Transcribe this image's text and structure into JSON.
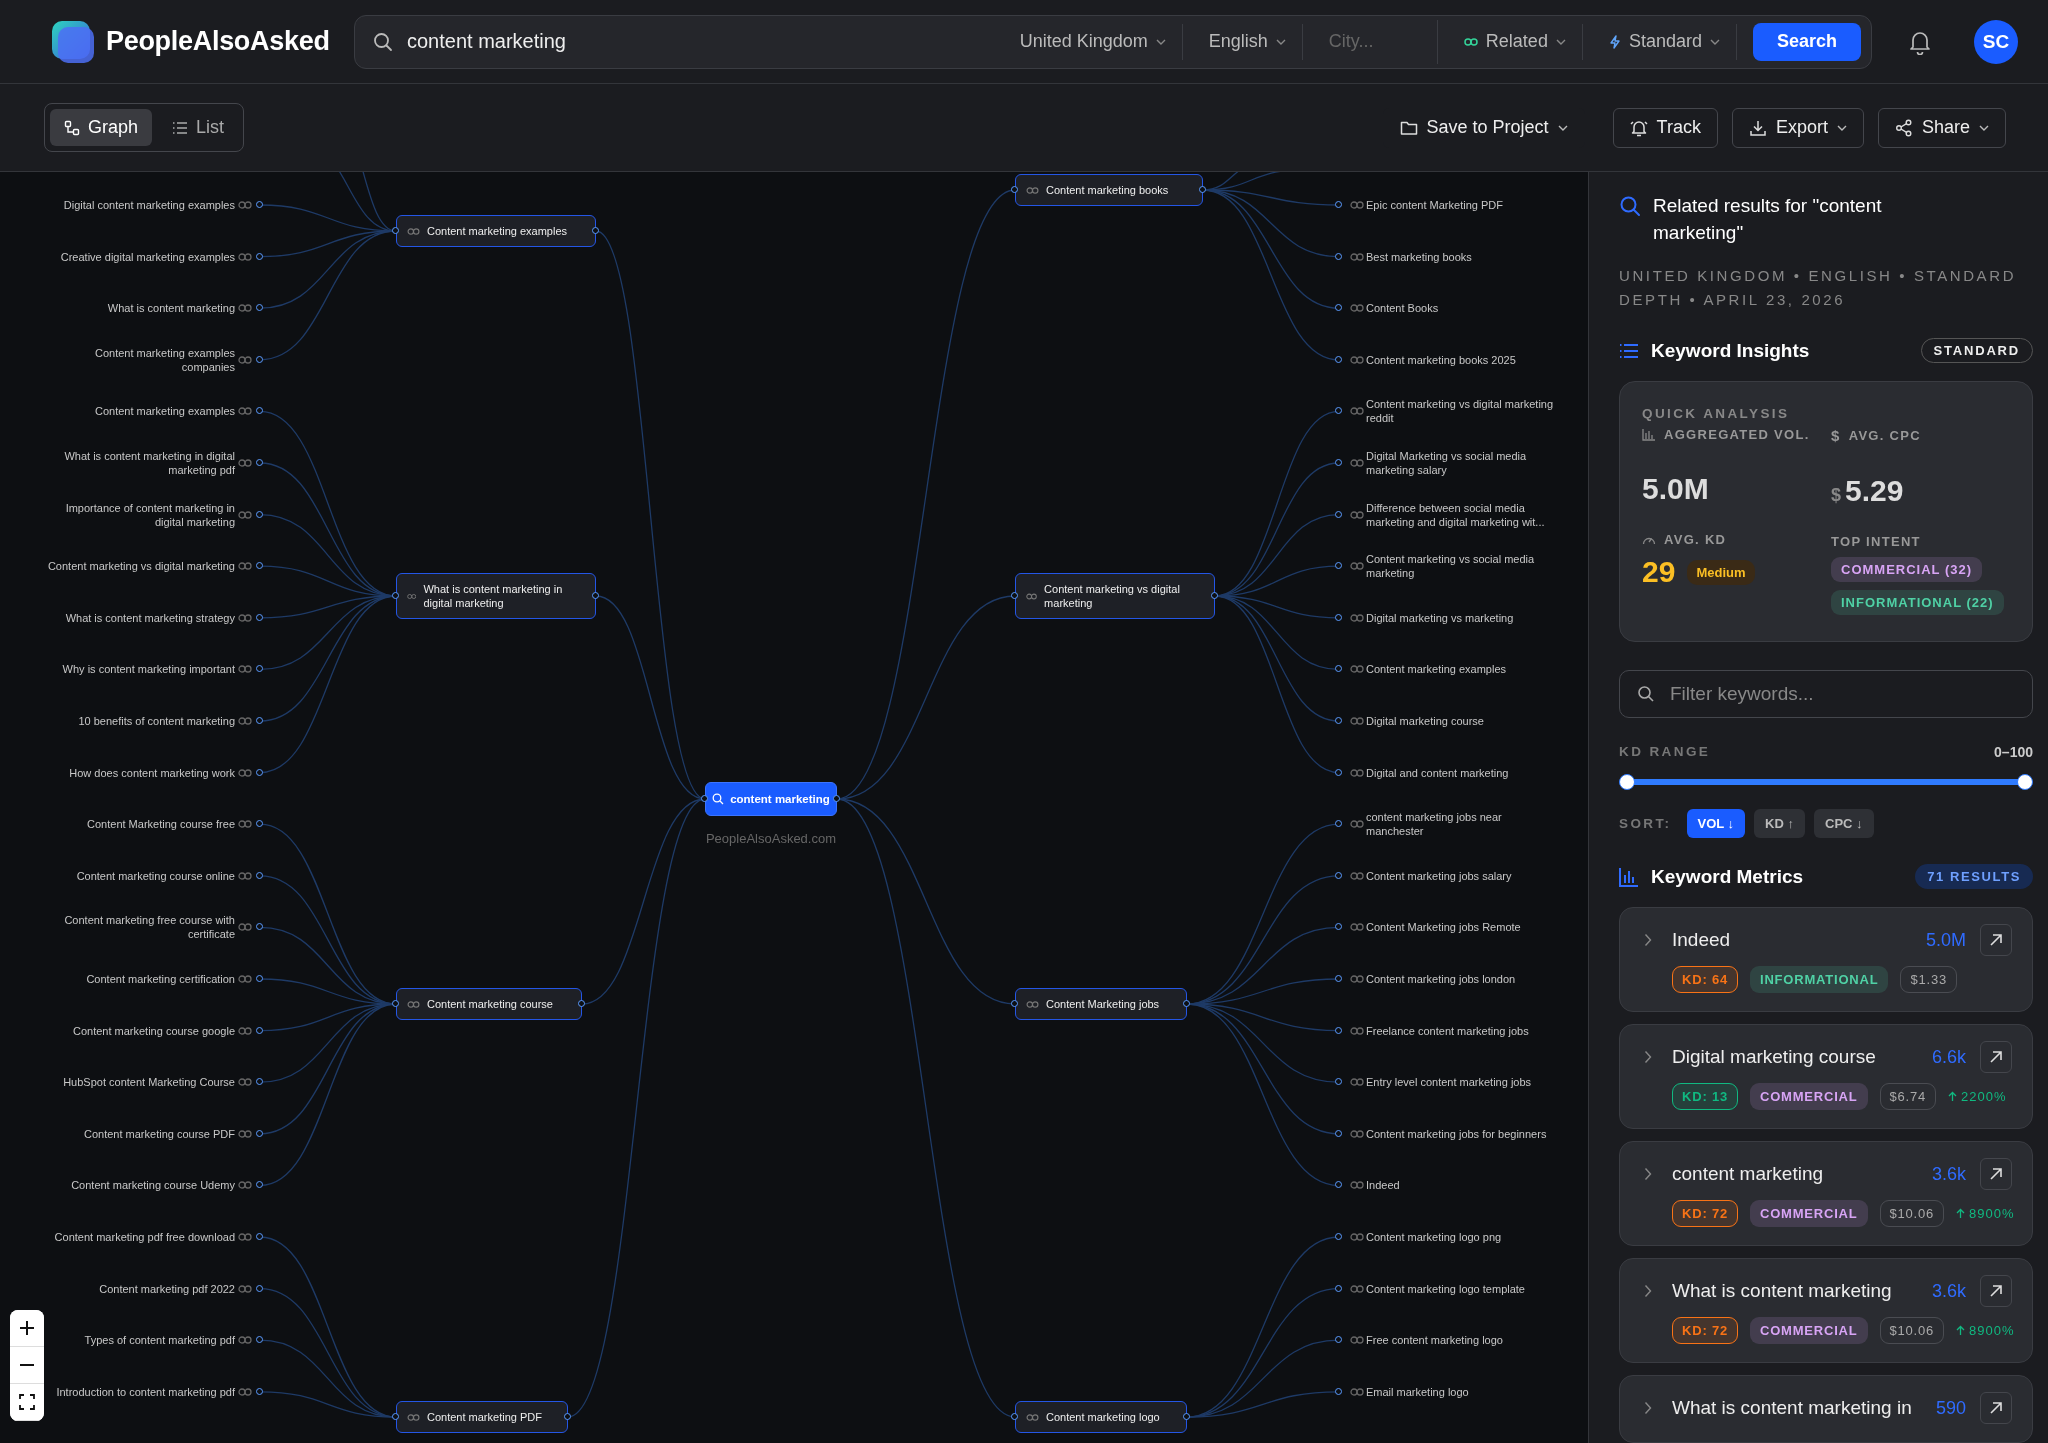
{
  "header": {
    "brand": "PeopleAlsoAsked",
    "query": "content marketing",
    "filters": [
      {
        "kind": "dropdown",
        "label": "United Kingdom"
      },
      {
        "kind": "dropdown",
        "label": "English"
      },
      {
        "kind": "input",
        "placeholder": "City..."
      },
      {
        "kind": "related",
        "label": "Related"
      },
      {
        "kind": "standard",
        "label": "Standard"
      }
    ],
    "search_button": "Search",
    "avatar": "SC"
  },
  "toolbar": {
    "views": [
      {
        "label": "Graph",
        "selected": true
      },
      {
        "label": "List",
        "selected": false
      }
    ],
    "actions": [
      {
        "kind": "folder",
        "label": "Save to Project",
        "menu": true
      },
      {
        "kind": "bell",
        "label": "Track",
        "menu": false
      },
      {
        "kind": "download",
        "label": "Export",
        "menu": true
      },
      {
        "kind": "share",
        "label": "Share",
        "menu": true
      }
    ]
  },
  "graph": {
    "center": {
      "label": "content marketing",
      "site": "PeopleAlsoAsked.com"
    },
    "left_branches": [
      {
        "label": "Content marketing examples",
        "children": [
          "Digital content marketing examples",
          "Creative digital marketing examples",
          "What is content marketing",
          "Content marketing examples companies"
        ]
      },
      {
        "label": "What is content marketing in digital marketing",
        "children": [
          "Content marketing examples",
          "What is content marketing in digital marketing pdf",
          "Importance of content marketing in digital marketing",
          "Content marketing vs digital marketing",
          "What is content marketing strategy",
          "Why is content marketing important",
          "10 benefits of content marketing",
          "How does content marketing work"
        ]
      },
      {
        "label": "Content marketing course",
        "children": [
          "Content Marketing course free",
          "Content marketing course online",
          "Content marketing free course with certificate",
          "Content marketing certification",
          "Content marketing course google",
          "HubSpot content Marketing Course",
          "Content marketing course PDF",
          "Content marketing course Udemy"
        ]
      },
      {
        "label": "Content marketing PDF",
        "children": [
          "Content marketing pdf free download",
          "Content marketing pdf 2022",
          "Types of content marketing pdf",
          "Introduction to content marketing pdf"
        ]
      }
    ],
    "right_branches": [
      {
        "label": "Content marketing books",
        "children": [
          "Epic content Marketing PDF",
          "Best marketing books",
          "Content Books",
          "Content marketing books 2025"
        ]
      },
      {
        "label": "Content marketing vs digital marketing",
        "children": [
          "Content marketing vs digital marketing reddit",
          "Digital Marketing vs social media marketing salary",
          "Difference between social media marketing and digital marketing wit...",
          "Content marketing vs social media marketing",
          "Digital marketing vs marketing",
          "Content marketing examples",
          "Digital marketing course",
          "Digital and content marketing"
        ]
      },
      {
        "label": "Content Marketing jobs",
        "children": [
          "content marketing jobs near manchester",
          "Content marketing jobs salary",
          "Content Marketing jobs Remote",
          "Content marketing jobs london",
          "Freelance content marketing jobs",
          "Entry level content marketing jobs",
          "Content marketing jobs for beginners",
          "Indeed"
        ]
      },
      {
        "label": "Content marketing logo",
        "children": [
          "Content marketing logo png",
          "Content marketing logo template",
          "Free content marketing logo",
          "Email marketing logo"
        ]
      }
    ]
  },
  "panel": {
    "title": "Related results for \"content marketing\"",
    "meta": "UNITED KINGDOM • ENGLISH • STANDARD DEPTH • APRIL 23, 2026",
    "insights": {
      "title": "Keyword Insights",
      "badge": "STANDARD",
      "section": "QUICK ANALYSIS",
      "volume_label": "AGGREGATED VOL.",
      "volume": "5.0M",
      "cpc_label": "AVG. CPC",
      "cpc_currency": "$",
      "cpc": "5.29",
      "kd_label": "AVG. KD",
      "kd": "29",
      "kd_rating": "Medium",
      "intent_label": "TOP INTENT",
      "intents": [
        {
          "label": "COMMERCIAL (32)",
          "color": "#d8a4f5"
        },
        {
          "label": "INFORMATIONAL (22)",
          "color": "#4fd1a5"
        }
      ]
    },
    "filter": {
      "placeholder": "Filter keywords..."
    },
    "kd_range": {
      "label": "KD RANGE",
      "reading": "0–100",
      "thumbs": [
        {
          "level": 0
        },
        {
          "level": 1
        }
      ]
    },
    "sort": {
      "label": "SORT:",
      "options": [
        {
          "label": "VOL ↓",
          "selected": true
        },
        {
          "label": "KD ↑",
          "selected": false
        },
        {
          "label": "CPC ↓",
          "selected": false
        }
      ]
    },
    "metrics": {
      "title": "Keyword Metrics",
      "count": "71 RESULTS",
      "items": [
        {
          "keyword": "Indeed",
          "volume": "5.0M",
          "kd": {
            "text": "KD: 64",
            "color": "#f97316"
          },
          "intent": {
            "text": "INFORMATIONAL",
            "color": "#4fd1a5"
          },
          "cpc": "$1.33"
        },
        {
          "keyword": "Digital marketing course",
          "volume": "6.6k",
          "kd": {
            "text": "KD: 13",
            "color": "#10b981"
          },
          "intent": {
            "text": "COMMERCIAL",
            "color": "#d8a4f5"
          },
          "cpc": "$6.74",
          "trend": "2200%"
        },
        {
          "keyword": "content marketing",
          "volume": "3.6k",
          "kd": {
            "text": "KD: 72",
            "color": "#f97316"
          },
          "intent": {
            "text": "COMMERCIAL",
            "color": "#d8a4f5"
          },
          "cpc": "$10.06",
          "trend": "8900%"
        },
        {
          "keyword": "What is content marketing",
          "volume": "3.6k",
          "kd": {
            "text": "KD: 72",
            "color": "#f97316"
          },
          "intent": {
            "text": "COMMERCIAL",
            "color": "#d8a4f5"
          },
          "cpc": "$10.06",
          "trend": "8900%"
        },
        {
          "keyword": "What is content marketing in",
          "volume": "590"
        }
      ]
    }
  }
}
